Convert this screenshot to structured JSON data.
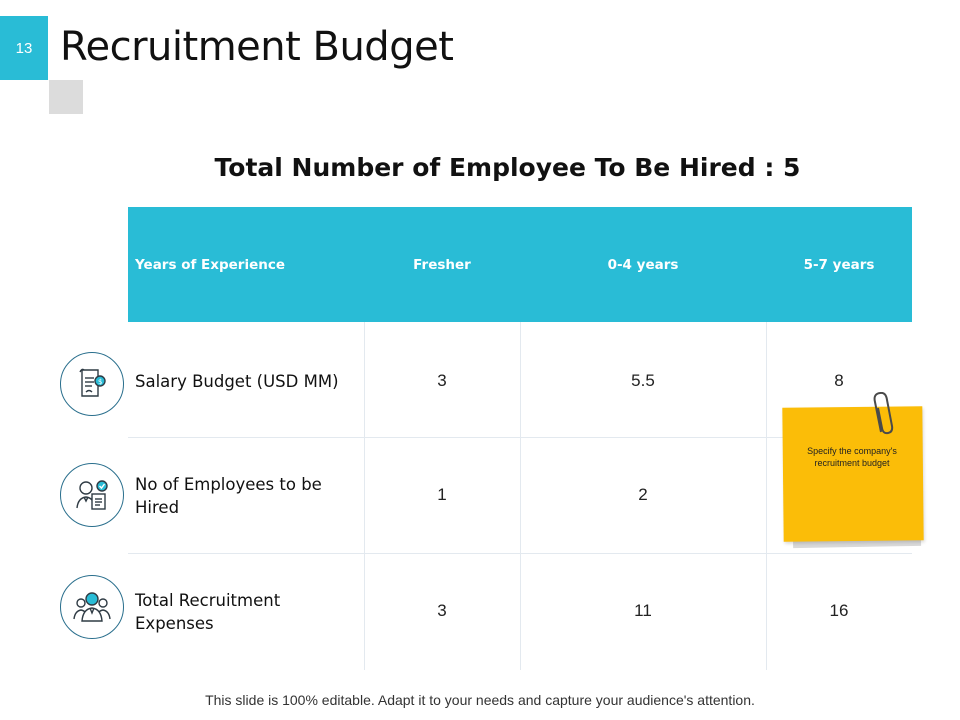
{
  "page_number": "13",
  "title": "Recruitment Budget",
  "subtitle": "Total Number of Employee To Be Hired : 5",
  "table": {
    "headers": [
      "Years of Experience",
      "Fresher",
      "0-4 years",
      "5-7 years"
    ],
    "rows": [
      {
        "label": "Salary Budget (USD MM)",
        "values": [
          "3",
          "5.5",
          "8"
        ],
        "icon": "salary-document-icon"
      },
      {
        "label": "No of Employees to be Hired",
        "values": [
          "1",
          "2",
          ""
        ],
        "icon": "employee-hire-icon"
      },
      {
        "label": "Total Recruitment Expenses",
        "values": [
          "3",
          "11",
          "16"
        ],
        "icon": "team-group-icon"
      }
    ]
  },
  "sticky_note": {
    "text": "Specify the company's recruitment budget",
    "color": "#fbbd08"
  },
  "footer": "This slide is 100% editable. Adapt it to your needs and capture your audience's attention.",
  "colors": {
    "accent": "#29bcd6",
    "icon_stroke": "#2a6f8d"
  }
}
